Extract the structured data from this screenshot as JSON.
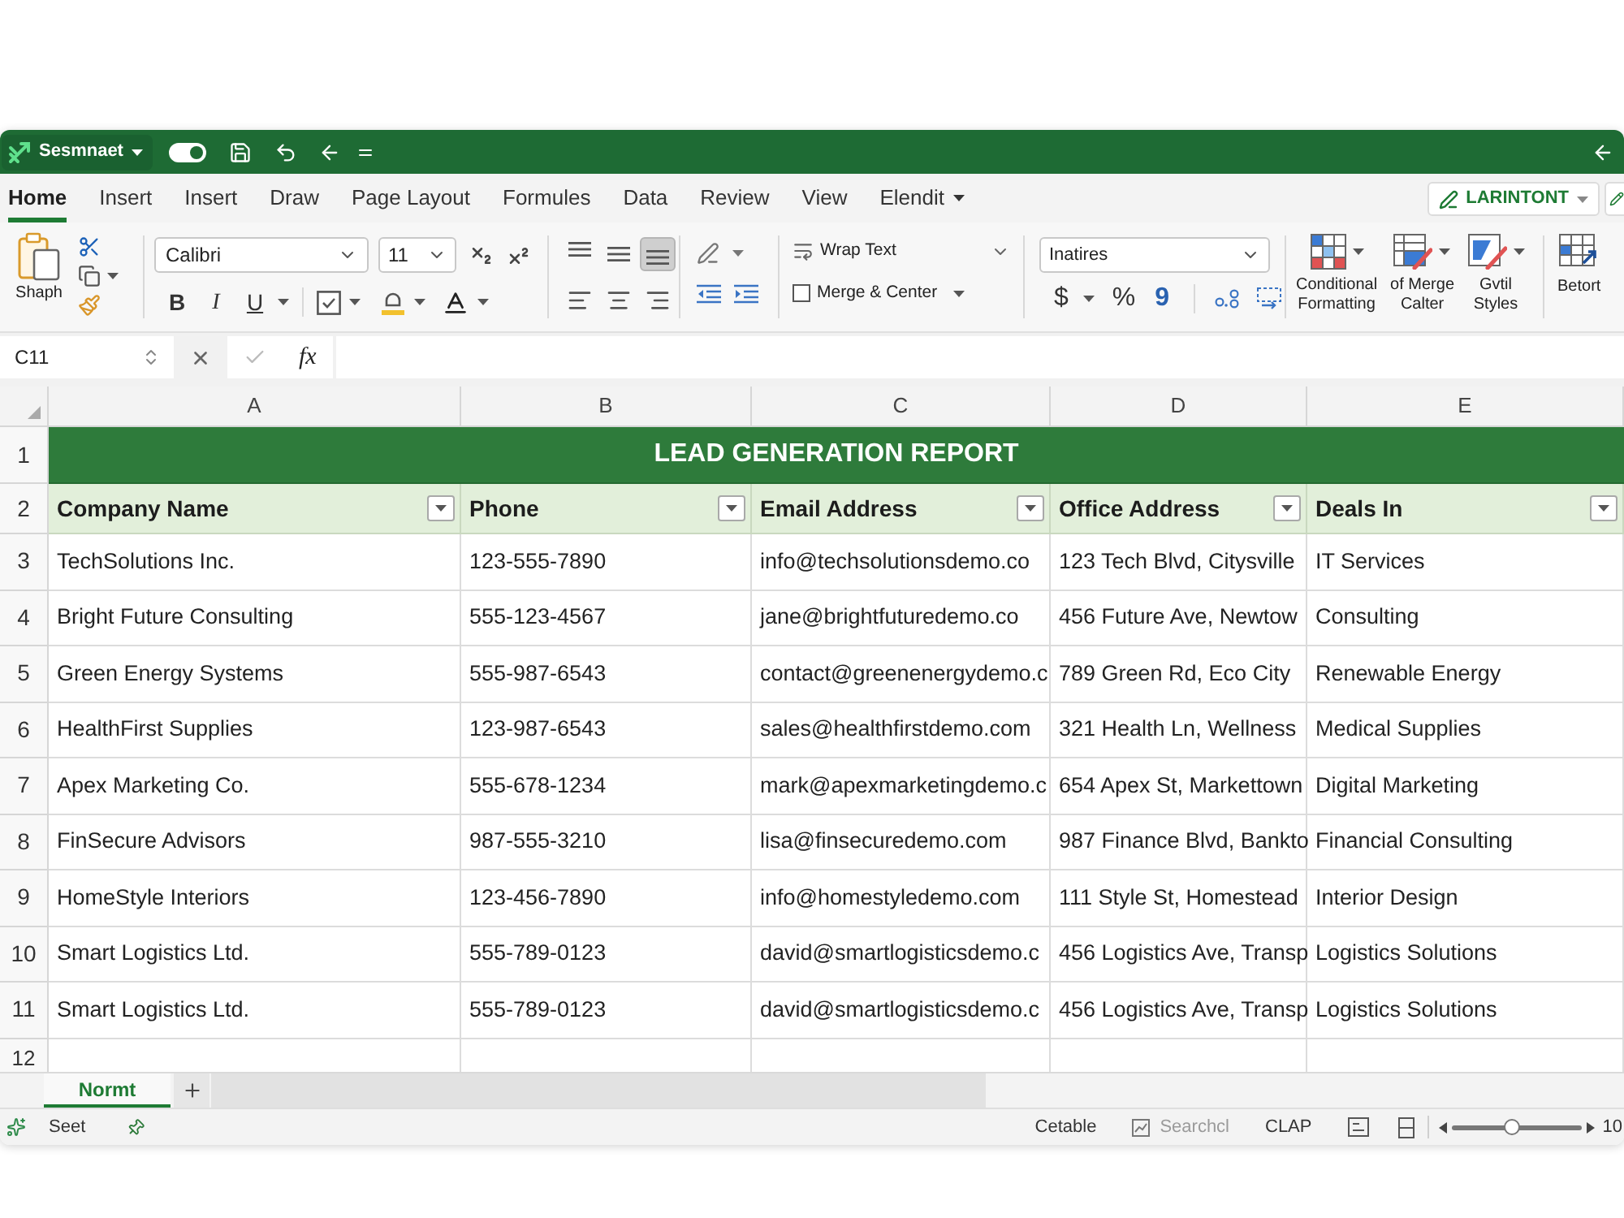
{
  "title_bar": {
    "app_menu": "Sesmnaet",
    "autosave": {
      "on": true
    }
  },
  "ribbon_tabs": [
    {
      "label": "Home",
      "kind": "tab",
      "selected": true
    },
    {
      "label": "Insert",
      "kind": "tab",
      "selected": false
    },
    {
      "label": "Insert",
      "kind": "tab",
      "selected": false
    },
    {
      "label": "Draw",
      "kind": "tab",
      "selected": false
    },
    {
      "label": "Page Layout",
      "kind": "tab",
      "selected": false
    },
    {
      "label": "Formules",
      "kind": "tab",
      "selected": false
    },
    {
      "label": "Data",
      "kind": "tab",
      "selected": false
    },
    {
      "label": "Review",
      "kind": "tab",
      "selected": false
    },
    {
      "label": "View",
      "kind": "tab",
      "selected": false
    },
    {
      "label": "Elendit",
      "kind": "menu",
      "selected": false
    }
  ],
  "account_button": {
    "label": "LARINTONT"
  },
  "ribbon": {
    "clipboard": {
      "paste_label": "Shaph"
    },
    "font": {
      "name": "Calibri",
      "size": "11"
    },
    "text_styles": [
      {
        "label": "B",
        "kind": "bold"
      },
      {
        "label": "I",
        "kind": "italic"
      },
      {
        "label": "U",
        "kind": "underline"
      }
    ],
    "vertical_align": [
      {
        "kind": "top",
        "selected": false
      },
      {
        "kind": "middle",
        "selected": false
      },
      {
        "kind": "bottom",
        "selected": true
      }
    ],
    "wrap_text": "Wrap Text",
    "merge": "Merge & Center",
    "number_format": "Inatires",
    "number_buttons": [
      {
        "label": "$",
        "kind": "currency"
      },
      {
        "label": "%",
        "kind": "percent"
      },
      {
        "label": "9",
        "kind": "comma"
      }
    ],
    "style_buttons": [
      {
        "kind": "conditional",
        "lines": [
          "Conditional",
          "Formatting"
        ]
      },
      {
        "kind": "table",
        "lines": [
          "of Merge",
          "Calter"
        ]
      },
      {
        "kind": "cell",
        "lines": [
          "Gvtil",
          "Styles"
        ]
      }
    ],
    "last_button": "Betort"
  },
  "formula_bar": {
    "name_box": "C11",
    "function_label": "fx"
  },
  "sheet": {
    "columns": [
      "A",
      "B",
      "C",
      "D",
      "E"
    ],
    "row_numbers": [
      "1",
      "2",
      "3",
      "4",
      "5",
      "6",
      "7",
      "8",
      "9",
      "10",
      "11",
      "12"
    ],
    "title": "LEAD GENERATION REPORT",
    "headers": [
      "Company Name",
      "Phone",
      "Email Address",
      "Office Address",
      "Deals In"
    ],
    "rows": [
      [
        "TechSolutions Inc.",
        "123-555-7890",
        "info@techsolutionsdemo.co",
        "123 Tech Blvd, Citysville",
        "IT Services"
      ],
      [
        "Bright Future Consulting",
        "555-123-4567",
        "jane@brightfuturedemo.co",
        "456 Future Ave, Newtow",
        "Consulting"
      ],
      [
        "Green Energy Systems",
        "555-987-6543",
        "contact@greenenergydemo.c",
        "789 Green Rd, Eco City",
        "Renewable Energy"
      ],
      [
        "HealthFirst Supplies",
        "123-987-6543",
        "sales@healthfirstdemo.com",
        "321 Health Ln, Wellness",
        "Medical Supplies"
      ],
      [
        "Apex Marketing Co.",
        "555-678-1234",
        "mark@apexmarketingdemo.c",
        "654 Apex St, Markettown",
        "Digital Marketing"
      ],
      [
        "FinSecure Advisors",
        "987-555-3210",
        "lisa@finsecuredemo.com",
        "987 Finance Blvd, Bankto",
        "Financial Consulting"
      ],
      [
        "HomeStyle Interiors",
        "123-456-7890",
        "info@homestyledemo.com",
        "111 Style St, Homestead",
        "Interior Design"
      ],
      [
        "Smart Logistics Ltd.",
        "555-789-0123",
        "david@smartlogisticsdemo.c",
        "456 Logistics Ave, Transp",
        "Logistics Solutions"
      ],
      [
        "Smart Logistics Ltd.",
        "555-789-0123",
        "david@smartlogisticsdemo.c",
        "456 Logistics Ave, Transp",
        "Logistics Solutions"
      ]
    ]
  },
  "sheet_tabs": [
    {
      "label": "Normt",
      "selected": true
    }
  ],
  "status_bar": {
    "mode": "Seet",
    "items": [
      {
        "kind": "text",
        "label": "Cetable",
        "disabled": false
      },
      {
        "kind": "icon_text",
        "label": "Searchcl",
        "disabled": true
      },
      {
        "kind": "text",
        "label": "CLAP",
        "disabled": false
      }
    ],
    "zoom": {
      "level": 0.46,
      "reading": "10"
    }
  }
}
